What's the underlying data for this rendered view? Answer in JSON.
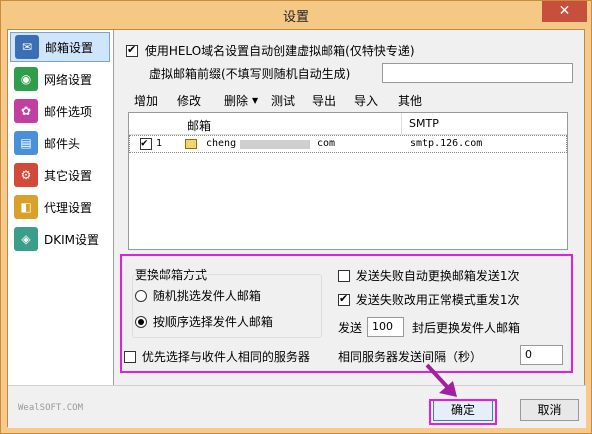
{
  "window": {
    "title": "设置",
    "close_glyph": "✕"
  },
  "sidebar": {
    "items": [
      {
        "label": "邮箱设置",
        "icon": "mail-settings-icon",
        "color": "#3a6fb5",
        "active": true
      },
      {
        "label": "网络设置",
        "icon": "network-icon",
        "color": "#2f9e4a",
        "active": false
      },
      {
        "label": "邮件选项",
        "icon": "mail-options-icon",
        "color": "#c03fa0",
        "active": false
      },
      {
        "label": "邮件头",
        "icon": "mail-header-icon",
        "color": "#4a90d9",
        "active": false
      },
      {
        "label": "其它设置",
        "icon": "other-settings-icon",
        "color": "#d14a3a",
        "active": false
      },
      {
        "label": "代理设置",
        "icon": "proxy-icon",
        "color": "#d9a12a",
        "active": false
      },
      {
        "label": "DKIM设置",
        "icon": "dkim-icon",
        "color": "#3a9e8a",
        "active": false
      }
    ]
  },
  "mailbox": {
    "helo_checkbox_label": "使用HELO域名设置自动创建虚拟邮箱(仅特快专递)",
    "helo_checked": true,
    "prefix_label": "虚拟邮箱前缀(不填写则随机自动生成)",
    "prefix_value": ""
  },
  "toolbar": {
    "add": "增加",
    "edit": "修改",
    "delete": "删除",
    "delete_arrow": "▼",
    "test": "测试",
    "export": "导出",
    "import": "导入",
    "other": "其他"
  },
  "table": {
    "columns": [
      "邮箱",
      "SMTP"
    ],
    "rows": [
      {
        "checked": true,
        "index": "1",
        "email_start": "cheng",
        "email_end": "com",
        "smtp": "smtp.126.com"
      }
    ]
  },
  "switch": {
    "group_title": "更换邮箱方式",
    "option_random": "随机挑选发件人邮箱",
    "option_sequential": "按顺序选择发件人邮箱",
    "selected": "sequential",
    "prefer_same_server_label": "优先选择与收件人相同的服务器",
    "prefer_same_server_checked": false,
    "auto_switch_on_fail_label": "发送失败自动更换邮箱发送1次",
    "auto_switch_on_fail_checked": false,
    "resend_normal_label": "发送失败改用正常模式重发1次",
    "resend_normal_checked": true,
    "send_prefix": "发送",
    "send_count": "100",
    "send_suffix": "封后更换发件人邮箱",
    "interval_label": "相同服务器发送间隔（秒）",
    "interval_value": "0"
  },
  "footer": {
    "brand": "WealSOFT.COM",
    "ok": "确定",
    "cancel": "取消"
  }
}
